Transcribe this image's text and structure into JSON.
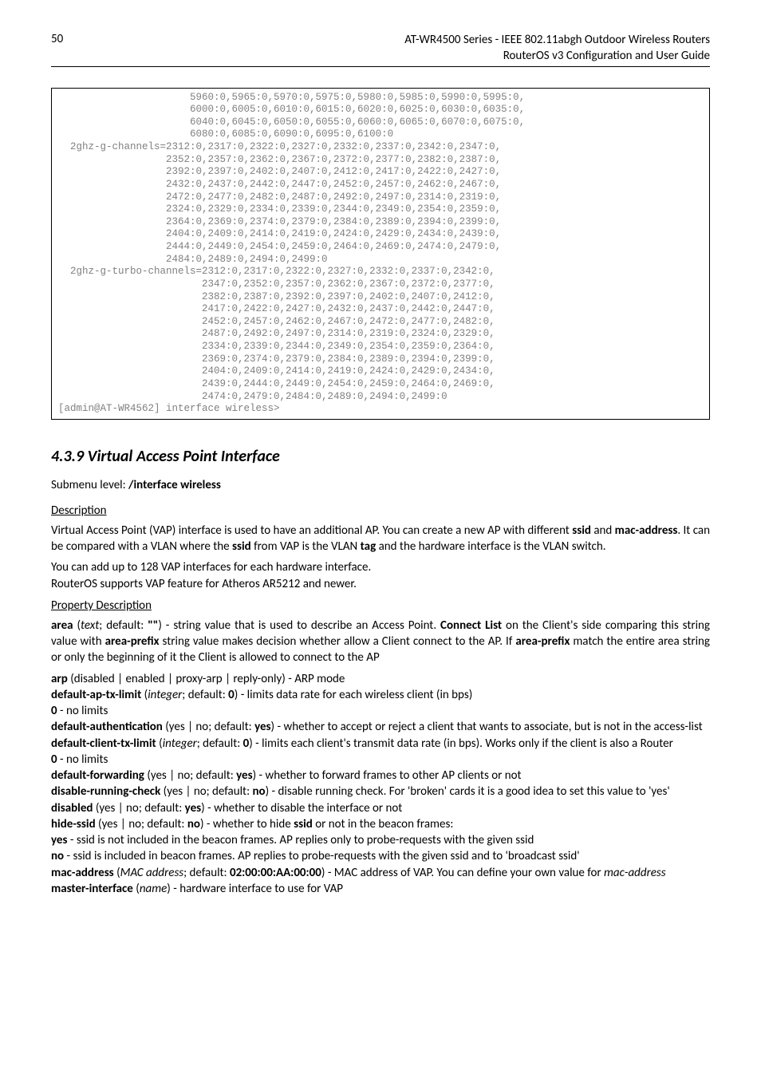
{
  "header": {
    "page_number": "50",
    "title_line1": "AT-WR4500 Series - IEEE 802.11abgh Outdoor Wireless Routers",
    "title_line2": "RouterOS v3 Configuration and User Guide"
  },
  "code": "                      5960:0,5965:0,5970:0,5975:0,5980:0,5985:0,5990:0,5995:0,\n                      6000:0,6005:0,6010:0,6015:0,6020:0,6025:0,6030:0,6035:0,\n                      6040:0,6045:0,6050:0,6055:0,6060:0,6065:0,6070:0,6075:0,\n                      6080:0,6085:0,6090:0,6095:0,6100:0\n  2ghz-g-channels=2312:0,2317:0,2322:0,2327:0,2332:0,2337:0,2342:0,2347:0,\n                  2352:0,2357:0,2362:0,2367:0,2372:0,2377:0,2382:0,2387:0,\n                  2392:0,2397:0,2402:0,2407:0,2412:0,2417:0,2422:0,2427:0,\n                  2432:0,2437:0,2442:0,2447:0,2452:0,2457:0,2462:0,2467:0,\n                  2472:0,2477:0,2482:0,2487:0,2492:0,2497:0,2314:0,2319:0,\n                  2324:0,2329:0,2334:0,2339:0,2344:0,2349:0,2354:0,2359:0,\n                  2364:0,2369:0,2374:0,2379:0,2384:0,2389:0,2394:0,2399:0,\n                  2404:0,2409:0,2414:0,2419:0,2424:0,2429:0,2434:0,2439:0,\n                  2444:0,2449:0,2454:0,2459:0,2464:0,2469:0,2474:0,2479:0,\n                  2484:0,2489:0,2494:0,2499:0\n  2ghz-g-turbo-channels=2312:0,2317:0,2322:0,2327:0,2332:0,2337:0,2342:0,\n                        2347:0,2352:0,2357:0,2362:0,2367:0,2372:0,2377:0,\n                        2382:0,2387:0,2392:0,2397:0,2402:0,2407:0,2412:0,\n                        2417:0,2422:0,2427:0,2432:0,2437:0,2442:0,2447:0,\n                        2452:0,2457:0,2462:0,2467:0,2472:0,2477:0,2482:0,\n                        2487:0,2492:0,2497:0,2314:0,2319:0,2324:0,2329:0,\n                        2334:0,2339:0,2344:0,2349:0,2354:0,2359:0,2364:0,\n                        2369:0,2374:0,2379:0,2384:0,2389:0,2394:0,2399:0,\n                        2404:0,2409:0,2414:0,2419:0,2424:0,2429:0,2434:0,\n                        2439:0,2444:0,2449:0,2454:0,2459:0,2464:0,2469:0,\n                        2474:0,2479:0,2484:0,2489:0,2494:0,2499:0\n[admin@AT-WR4562] interface wireless>",
  "section": {
    "number_title": "4.3.9  Virtual Access Point Interface",
    "submenu_prefix": "Submenu level: ",
    "submenu_value": "/interface wireless"
  },
  "description": {
    "heading": "Description",
    "p1a": "Virtual Access Point (VAP) interface is used to have an additional AP. You can create a new AP with different ",
    "p1b_ssid": "ssid",
    "p1c": " and ",
    "p1d_mac": "mac-address",
    "p1e": ". It can be compared with a VLAN where the ",
    "p1f_ssid2": "ssid",
    "p1g": " from VAP is the VLAN ",
    "p1h_tag": "tag",
    "p1i": " and the hardware interface is the VLAN switch.",
    "p2": "You can add up to 128 VAP interfaces for each hardware interface.",
    "p3": "RouterOS supports VAP feature for Atheros AR5212 and newer."
  },
  "props": {
    "heading": "Property Description",
    "area": {
      "name": "area",
      "type": "text",
      "default_label": "; default: ",
      "default": "\"\"",
      "desc1": ") - string value that is used to describe an Access Point. ",
      "connect_list": "Connect List",
      "desc2": " on the Client's side comparing this string value with ",
      "area_prefix": "area-prefix",
      "desc3": " string value makes decision whether allow a Client connect to the AP. If ",
      "desc4": " match the entire area string or only the beginning of it the Client is allowed to connect to the AP"
    },
    "arp": {
      "name": "arp",
      "opts": " (disabled | enabled | proxy-arp | reply-only) - ARP mode"
    },
    "default_ap_tx_limit": {
      "name": "default-ap-tx-limit",
      "meta": " (",
      "type": "integer",
      "def": "; default: ",
      "defv": "0",
      "desc": ") - limits data rate for each wireless client (in bps)",
      "zero": "0",
      "zero_desc": " - no limits"
    },
    "default_authentication": {
      "name": "default-authentication",
      "meta": " (yes | no; default: ",
      "defv": "yes",
      "desc": ") - whether to accept or reject a client that wants to associate, but is not in the access-list"
    },
    "default_client_tx_limit": {
      "name": "default-client-tx-limit",
      "meta": " (",
      "type": "integer",
      "def": "; default: ",
      "defv": "0",
      "desc": ") - limits each client's transmit data rate (in bps). Works only if the client is also a Router",
      "zero": "0",
      "zero_desc": " - no limits"
    },
    "default_forwarding": {
      "name": "default-forwarding",
      "meta": " (yes | no; default: ",
      "defv": "yes",
      "desc": ") - whether to forward frames to other AP clients or not"
    },
    "disable_running_check": {
      "name": "disable-running-check",
      "meta": " (yes | no; default: ",
      "defv": "no",
      "desc": ") - disable running check. For 'broken' cards it is a good idea to set this value to 'yes'"
    },
    "disabled": {
      "name": "disabled",
      "meta": " (yes | no; default: ",
      "defv": "yes",
      "desc": ") - whether to disable the interface or not"
    },
    "hide_ssid": {
      "name": "hide-ssid",
      "meta": " (yes | no; default: ",
      "defv": "no",
      "desc1": ") - whether to hide ",
      "ssid": "ssid",
      "desc2": " or not in the beacon frames:",
      "yes": "yes",
      "yes_desc": " - ssid is not included in the beacon frames. AP replies only to probe-requests with the given ssid",
      "no": "no",
      "no_desc": " - ssid is included in beacon frames. AP replies to probe-requests with the given ssid and to 'broadcast ssid'"
    },
    "mac_address": {
      "name": "mac-address",
      "meta": " (",
      "type": "MAC address",
      "def": "; default: ",
      "defv": "02:00:00:AA:00:00",
      "desc": ") - MAC address of VAP. You can define your own value for ",
      "ital": "mac-address"
    },
    "master_interface": {
      "name": "master-interface",
      "meta": " (",
      "type": "name",
      "desc": ") - hardware interface to use for VAP"
    }
  }
}
